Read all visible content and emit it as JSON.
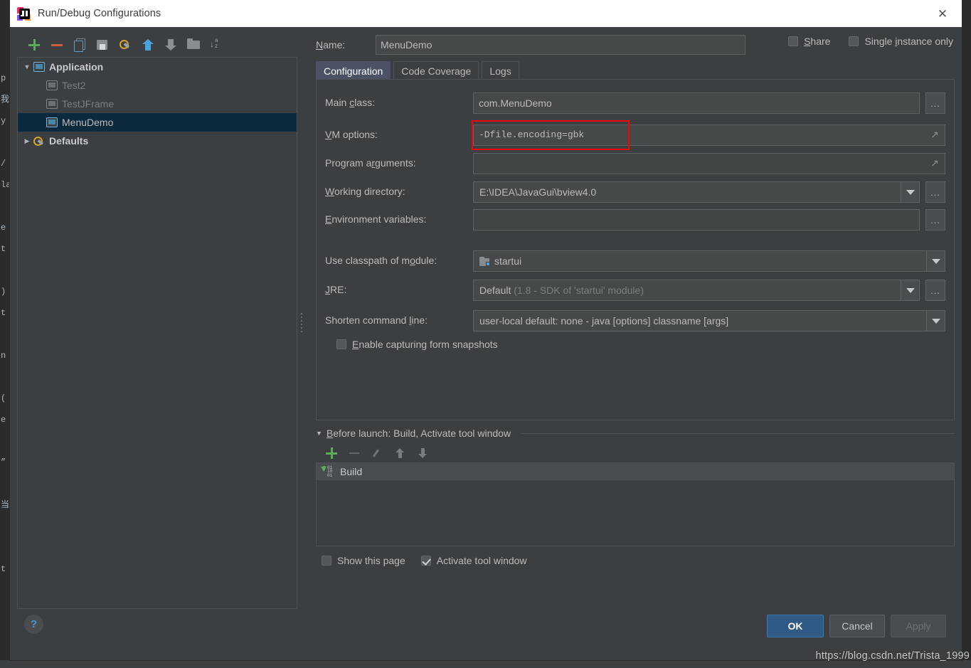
{
  "window": {
    "title": "Run/Debug Configurations",
    "logo_icon": "intellij-idea-logo",
    "close_icon": "close-icon"
  },
  "background_editor": {
    "code_fragment": "p\n我\ny\n\n/\nla\n\ne\nt\n\n)\nt\n\nn\n\n(\ne\n\n”\n\n当\n\n\nt"
  },
  "left_panel": {
    "toolbar": [
      {
        "name": "add-configuration-button",
        "icon": "plus-icon",
        "title": "Add New Configuration"
      },
      {
        "name": "remove-configuration-button",
        "icon": "minus-icon",
        "title": "Remove Configuration"
      },
      {
        "name": "copy-configuration-button",
        "icon": "copy-icon",
        "title": "Copy Configuration"
      },
      {
        "name": "save-configuration-button",
        "icon": "save-icon",
        "title": "Save Configuration"
      },
      {
        "name": "edit-defaults-button",
        "icon": "gear-wrench-icon",
        "title": "Edit Defaults"
      },
      {
        "name": "move-up-button",
        "icon": "arrow-up-icon",
        "title": "Move Up"
      },
      {
        "name": "move-down-button",
        "icon": "arrow-down-icon",
        "title": "Move Down"
      },
      {
        "name": "new-folder-button",
        "icon": "folder-icon",
        "title": "Create New Folder"
      },
      {
        "name": "sort-configurations-button",
        "icon": "sort-az-icon",
        "title": "Sort Configurations"
      }
    ],
    "tree": [
      {
        "label": "Application",
        "icon": "application-icon",
        "twisty": "expanded",
        "depth": 0,
        "style": "bold",
        "selected": false
      },
      {
        "label": "Test2",
        "icon": "application-icon",
        "twisty": "none",
        "depth": 1,
        "style": "dim",
        "selected": false
      },
      {
        "label": "TestJFrame",
        "icon": "application-icon",
        "twisty": "none",
        "depth": 1,
        "style": "dim",
        "selected": false
      },
      {
        "label": "MenuDemo",
        "icon": "application-icon",
        "twisty": "none",
        "depth": 1,
        "style": "normal",
        "selected": true
      },
      {
        "label": "Defaults",
        "icon": "gear-wrench-icon",
        "twisty": "collapsed",
        "depth": 0,
        "style": "bold",
        "selected": false
      }
    ]
  },
  "right_panel": {
    "name_label": "Name:",
    "name_value": "MenuDemo",
    "share": {
      "label": "Share",
      "checked": false
    },
    "single_instance": {
      "label": "Single instance only",
      "checked": false
    },
    "tabs": [
      {
        "label": "Configuration",
        "active": true
      },
      {
        "label": "Code Coverage",
        "active": false
      },
      {
        "label": "Logs",
        "active": false
      }
    ],
    "fields": [
      {
        "label": "Main class:",
        "value": "com.MenuDemo",
        "placeholder": "",
        "control": "text-with-browse",
        "browse_label": "...",
        "highlighted": false
      },
      {
        "label": "VM options:",
        "value": "-Dfile.encoding=gbk",
        "placeholder": "",
        "control": "text-with-expand",
        "mono": true,
        "highlighted": true
      },
      {
        "label": "Program arguments:",
        "value": "",
        "placeholder": "",
        "control": "text-with-expand",
        "highlighted": false
      },
      {
        "label": "Working directory:",
        "value": "E:\\IDEA\\JavaGui\\bview4.0",
        "placeholder": "",
        "control": "combo-with-browse",
        "browse_label": "...",
        "highlighted": false
      },
      {
        "label": "Environment variables:",
        "value": "",
        "placeholder": "",
        "control": "text-with-browse",
        "browse_label": "...",
        "highlighted": false
      }
    ],
    "module_field": {
      "label": "Use classpath of module:",
      "value": "startui",
      "icon": "module-icon",
      "control": "combo"
    },
    "jre_field": {
      "label": "JRE:",
      "value_main": "Default",
      "value_dim": "(1.8 - SDK of 'startui' module)",
      "control": "combo-with-browse",
      "browse_label": "..."
    },
    "shorten_field": {
      "label": "Shorten command line:",
      "value": "user-local default: none - java [options] classname [args]",
      "control": "combo"
    },
    "snapshots_checkbox": {
      "label": "Enable capturing form snapshots",
      "checked": false
    },
    "before_launch": {
      "header": "Before launch: Build, Activate tool window",
      "twisty": "expanded",
      "toolbar": [
        {
          "name": "before-launch-add-button",
          "icon": "plus-icon",
          "enabled": true
        },
        {
          "name": "before-launch-remove-button",
          "icon": "minus-icon",
          "enabled": false
        },
        {
          "name": "before-launch-edit-button",
          "icon": "pencil-icon",
          "enabled": false
        },
        {
          "name": "before-launch-move-up-button",
          "icon": "arrow-up-icon",
          "enabled": false
        },
        {
          "name": "before-launch-move-down-button",
          "icon": "arrow-down-icon",
          "enabled": false
        }
      ],
      "items": [
        {
          "label": "Build",
          "icon": "build-icon",
          "selected": true
        }
      ]
    },
    "show_this_page": {
      "label": "Show this page",
      "checked": false
    },
    "activate_tool_window": {
      "label": "Activate tool window",
      "checked": true
    }
  },
  "footer": {
    "help_icon": "help-question-icon",
    "ok_label": "OK",
    "cancel_label": "Cancel",
    "apply_label": "Apply",
    "apply_disabled": true
  },
  "watermark": "https://blog.csdn.net/Trista_1999",
  "colors": {
    "dialog_bg": "#3c3f41",
    "field_bg": "#45494a",
    "text": "#bbbbbb",
    "selection": "#0d293e",
    "tab_active": "#4b5265",
    "accent_blue": "#4aa3df",
    "ok_button": "#2f5a85",
    "highlight_red": "#ff0000",
    "plus_green": "#5caa5c",
    "minus_red": "#c9603f"
  }
}
